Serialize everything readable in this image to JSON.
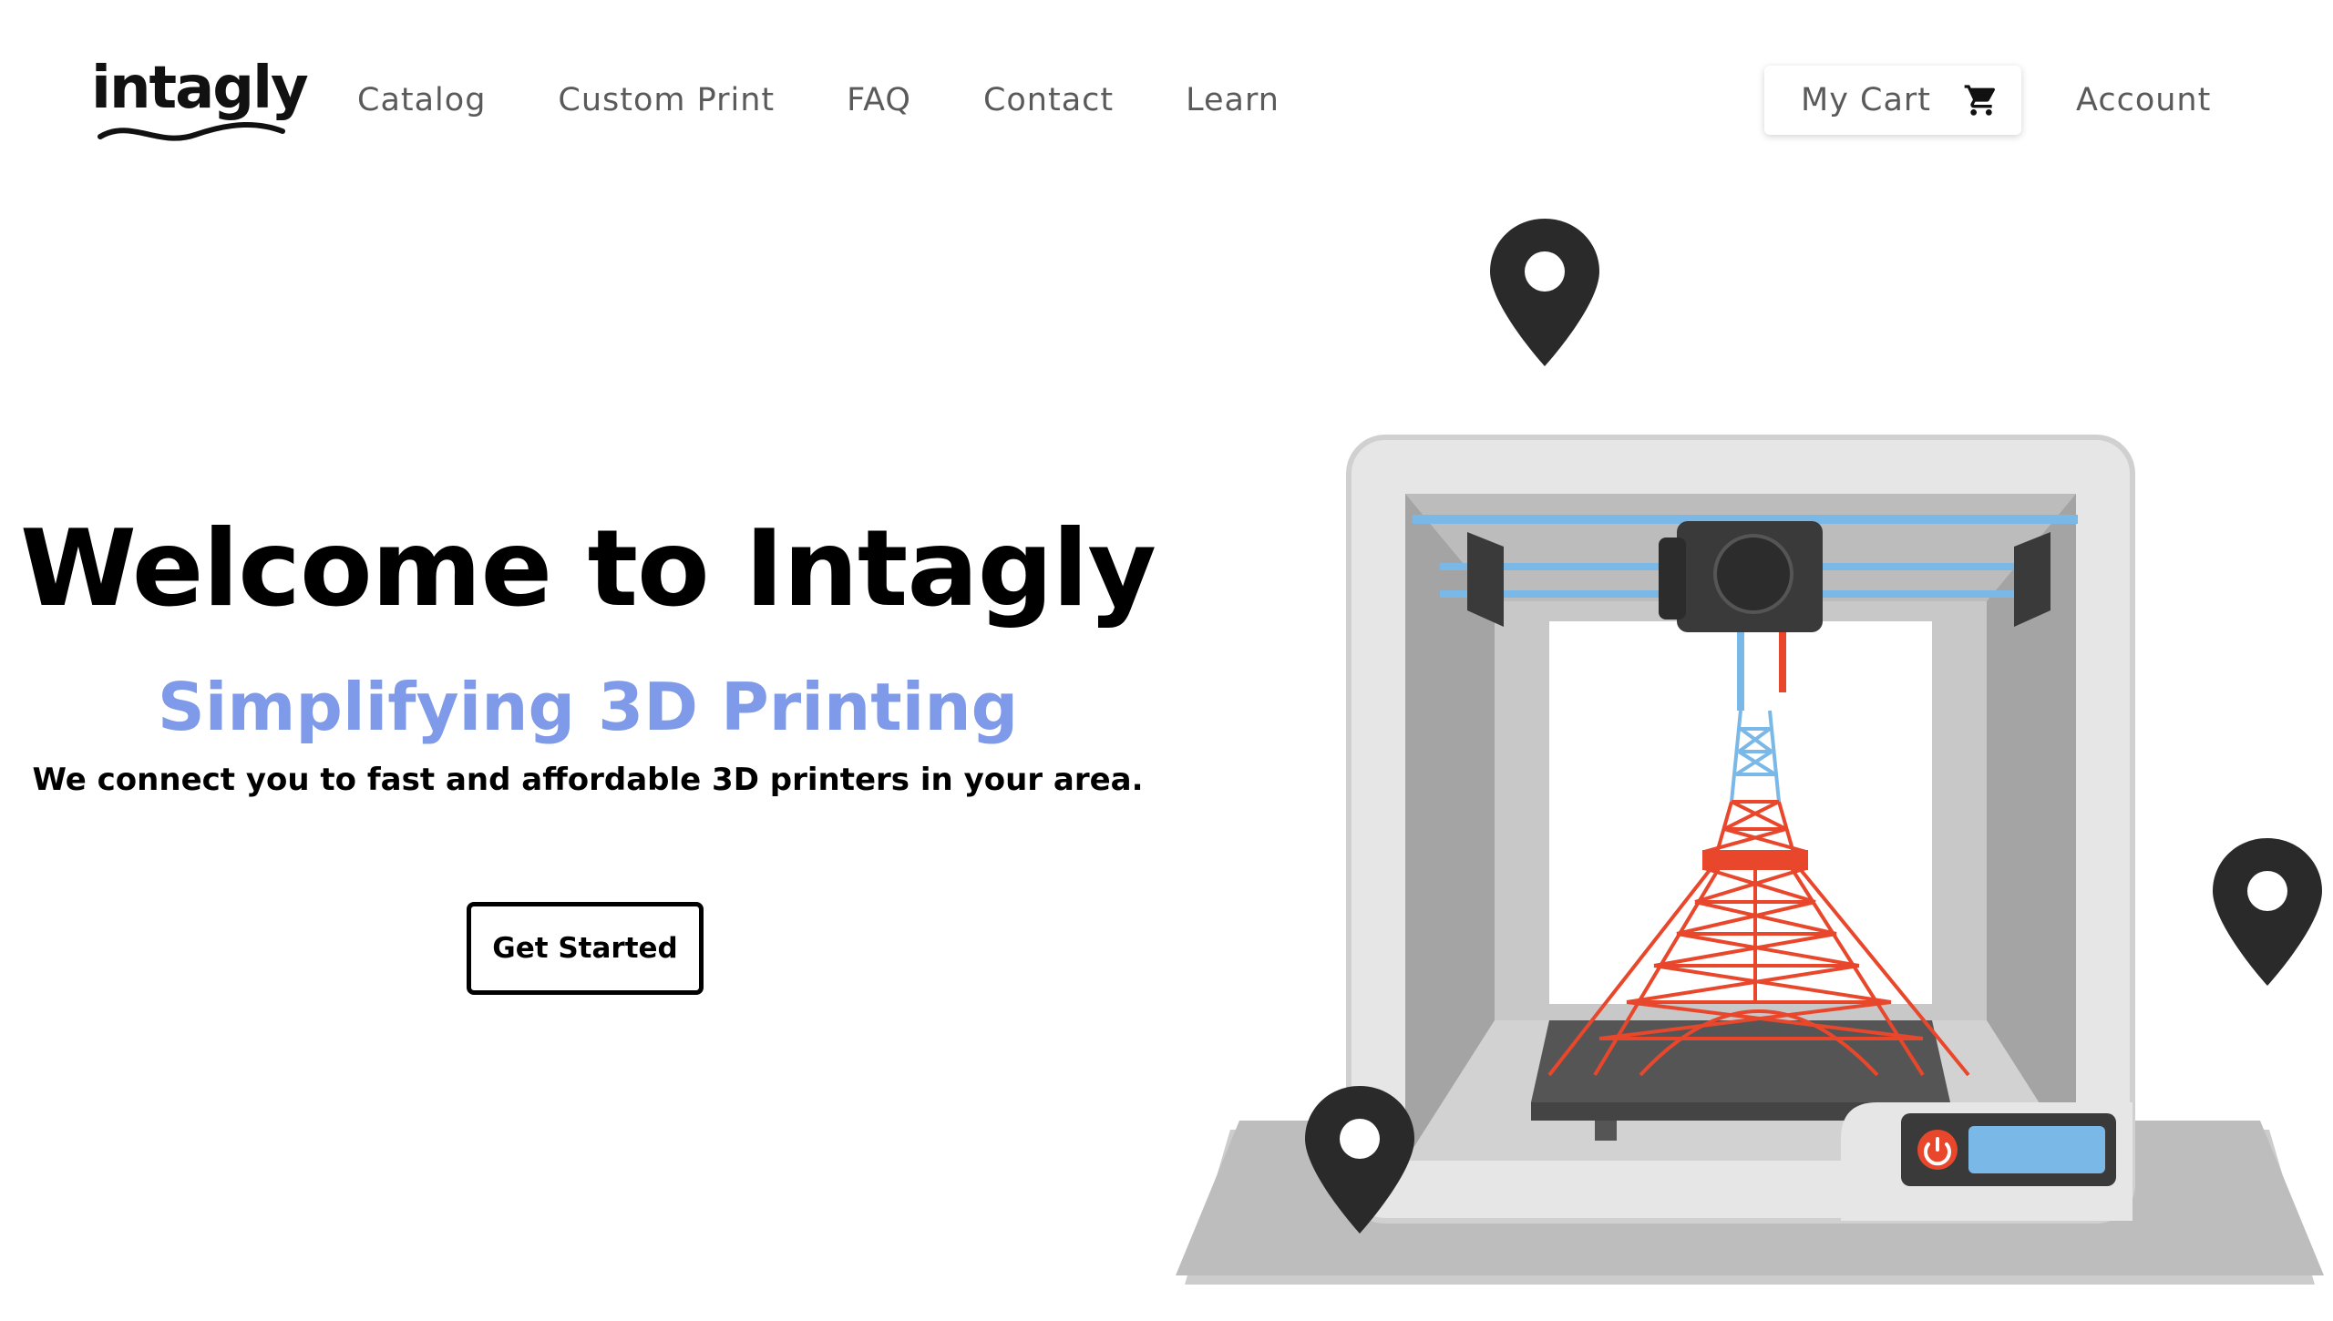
{
  "header": {
    "logo_text": "intagly",
    "nav": [
      {
        "label": "Catalog"
      },
      {
        "label": "Custom Print"
      },
      {
        "label": "FAQ"
      },
      {
        "label": "Contact"
      },
      {
        "label": "Learn"
      }
    ],
    "cart_label": "My Cart",
    "cart_icon": "shopping-cart-icon",
    "account_label": "Account"
  },
  "hero": {
    "title": "Welcome to Intagly",
    "subtitle": "Simplifying 3D Printing",
    "tagline": "We connect you to fast and affordable 3D printers in your area.",
    "cta_label": "Get Started"
  },
  "illustration": {
    "description_icons": [
      "map-pin-icon",
      "3d-printer-illustration",
      "tower-model",
      "power-icon"
    ]
  },
  "colors": {
    "subtitle": "#7f9ae8",
    "text": "#000000",
    "nav_text": "#5a5a5a",
    "tower": "#e8472c",
    "filament_blue": "#7ab8e8",
    "pin": "#2a2a2a"
  }
}
